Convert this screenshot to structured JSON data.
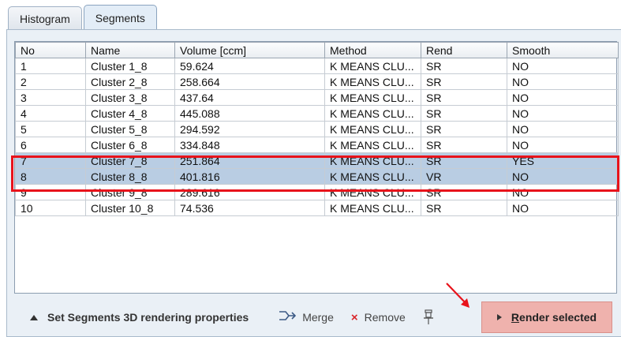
{
  "tabs": [
    {
      "label": "Histogram",
      "active": false
    },
    {
      "label": "Segments",
      "active": true
    }
  ],
  "table": {
    "columns": [
      "No",
      "Name",
      "Volume [ccm]",
      "Method",
      "Rend",
      "Smooth"
    ],
    "rows": [
      {
        "no": "1",
        "name": "Cluster 1_8",
        "volume": "59.624",
        "method": "K MEANS CLU...",
        "rend": "SR",
        "smooth": "NO",
        "selected": false
      },
      {
        "no": "2",
        "name": "Cluster 2_8",
        "volume": "258.664",
        "method": "K MEANS CLU...",
        "rend": "SR",
        "smooth": "NO",
        "selected": false
      },
      {
        "no": "3",
        "name": "Cluster 3_8",
        "volume": "437.64",
        "method": "K MEANS CLU...",
        "rend": "SR",
        "smooth": "NO",
        "selected": false
      },
      {
        "no": "4",
        "name": "Cluster 4_8",
        "volume": "445.088",
        "method": "K MEANS CLU...",
        "rend": "SR",
        "smooth": "NO",
        "selected": false
      },
      {
        "no": "5",
        "name": "Cluster 5_8",
        "volume": "294.592",
        "method": "K MEANS CLU...",
        "rend": "SR",
        "smooth": "NO",
        "selected": false
      },
      {
        "no": "6",
        "name": "Cluster 6_8",
        "volume": "334.848",
        "method": "K MEANS CLU...",
        "rend": "SR",
        "smooth": "NO",
        "selected": false
      },
      {
        "no": "7",
        "name": "Cluster 7_8",
        "volume": "251.864",
        "method": "K MEANS CLU...",
        "rend": "SR",
        "smooth": "YES",
        "selected": true
      },
      {
        "no": "8",
        "name": "Cluster 8_8",
        "volume": "401.816",
        "method": "K MEANS CLU...",
        "rend": "VR",
        "smooth": "NO",
        "selected": true
      },
      {
        "no": "9",
        "name": "Cluster 9_8",
        "volume": "289.616",
        "method": "K MEANS CLU...",
        "rend": "SR",
        "smooth": "NO",
        "selected": false
      },
      {
        "no": "10",
        "name": "Cluster 10_8",
        "volume": "74.536",
        "method": "K MEANS CLU...",
        "rend": "SR",
        "smooth": "NO",
        "selected": false
      }
    ]
  },
  "toolbar": {
    "expand_label": "Set Segments 3D rendering properties",
    "merge_label": "Merge",
    "remove_label": "Remove",
    "render_label_first": "R",
    "render_label_rest": "ender selected"
  },
  "colors": {
    "selection": "#b9cde3",
    "highlight": "#e8131b",
    "render_button": "#efb2ad",
    "panel": "#eaf0f6"
  },
  "icons": {
    "expand": "triangle-up-icon",
    "merge": "merge-icon",
    "remove": "cross-icon",
    "pin": "pin-icon",
    "render": "play-icon"
  }
}
